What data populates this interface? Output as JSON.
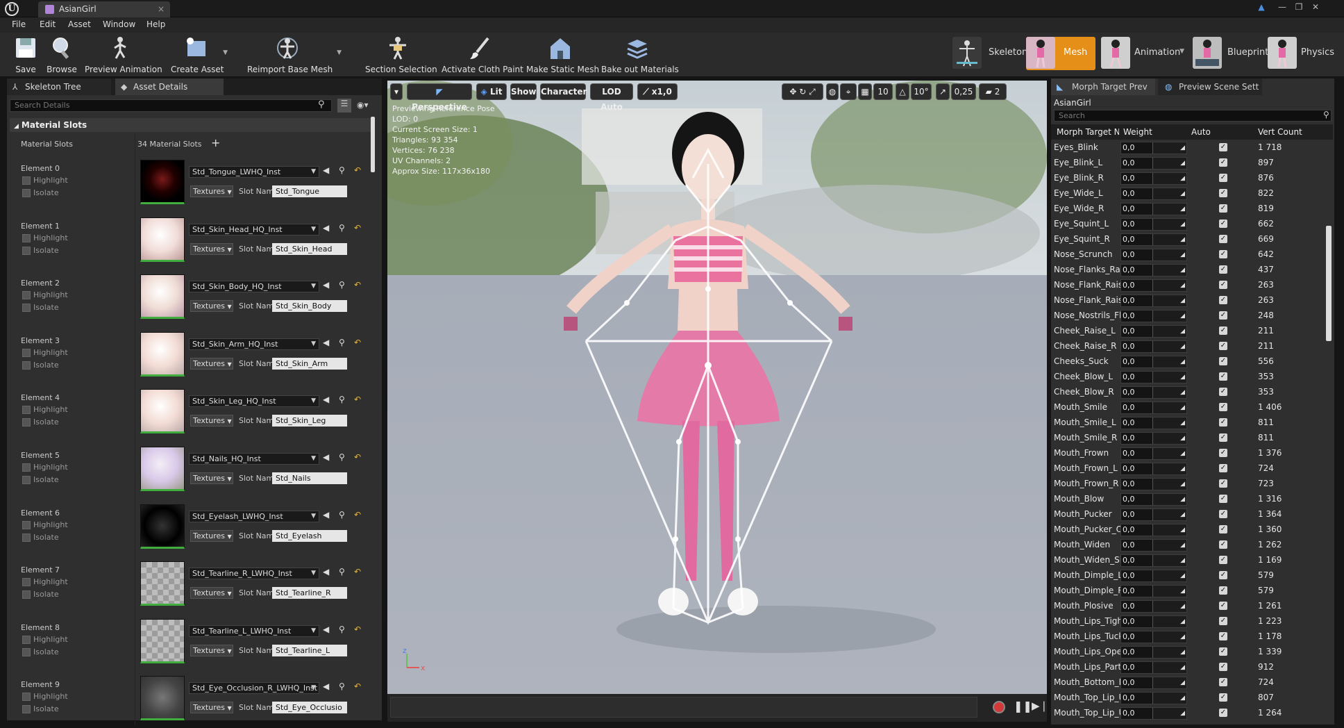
{
  "window": {
    "tab_title": "AsianGirl"
  },
  "menu": [
    "File",
    "Edit",
    "Asset",
    "Window",
    "Help"
  ],
  "toolbar": {
    "items": [
      "Save",
      "Browse",
      "Preview Animation",
      "Create Asset",
      "Reimport Base Mesh",
      "Section Selection",
      "Activate Cloth Paint",
      "Make Static Mesh",
      "Bake out Materials"
    ],
    "modes": [
      "Skeleton",
      "Mesh",
      "Animation",
      "Blueprint",
      "Physics"
    ]
  },
  "left": {
    "tabs": [
      "Skeleton Tree",
      "Asset Details"
    ],
    "search_placeholder": "Search Details",
    "section": "Material Slots",
    "col_label": "Material Slots",
    "slot_count": "34 Material Slots",
    "textures_label": "Textures",
    "slot_name_label": "Slot Name",
    "highlight_label": "Highlight",
    "isolate_label": "Isolate",
    "elements": [
      {
        "label": "Element 0",
        "material": "Std_Tongue_LWHQ_Inst",
        "slot": "Std_Tongue"
      },
      {
        "label": "Element 1",
        "material": "Std_Skin_Head_HQ_Inst",
        "slot": "Std_Skin_Head"
      },
      {
        "label": "Element 2",
        "material": "Std_Skin_Body_HQ_Inst",
        "slot": "Std_Skin_Body"
      },
      {
        "label": "Element 3",
        "material": "Std_Skin_Arm_HQ_Inst",
        "slot": "Std_Skin_Arm"
      },
      {
        "label": "Element 4",
        "material": "Std_Skin_Leg_HQ_Inst",
        "slot": "Std_Skin_Leg"
      },
      {
        "label": "Element 5",
        "material": "Std_Nails_HQ_Inst",
        "slot": "Std_Nails"
      },
      {
        "label": "Element 6",
        "material": "Std_Eyelash_LWHQ_Inst",
        "slot": "Std_Eyelash"
      },
      {
        "label": "Element 7",
        "material": "Std_Tearline_R_LWHQ_Inst",
        "slot": "Std_Tearline_R"
      },
      {
        "label": "Element 8",
        "material": "Std_Tearline_L_LWHQ_Inst",
        "slot": "Std_Tearline_L"
      },
      {
        "label": "Element 9",
        "material": "Std_Eye_Occlusion_R_LWHQ_Inst",
        "slot": "Std_Eye_Occlusio"
      }
    ]
  },
  "viewport": {
    "buttons": [
      "Perspective",
      "Lit",
      "Show",
      "Character",
      "LOD Auto",
      "x1,0"
    ],
    "right_values": [
      "10",
      "10°",
      "0,25",
      "2"
    ],
    "info": [
      "Previewing Reference Pose",
      "LOD: 0",
      "Current Screen Size: 1",
      "Triangles: 93 354",
      "Vertices: 76 238",
      "UV Channels: 2",
      "Approx Size: 117x36x180"
    ]
  },
  "right": {
    "tabs": [
      "Morph Target Prev",
      "Preview Scene Sett"
    ],
    "asset": "AsianGirl",
    "search_placeholder": "Search",
    "headers": [
      "Morph Target Na",
      "Weight",
      "Auto",
      "Vert Count"
    ],
    "rows": [
      {
        "name": "Eyes_Blink",
        "weight": "0,0",
        "count": "1 718"
      },
      {
        "name": "Eye_Blink_L",
        "weight": "0,0",
        "count": "897"
      },
      {
        "name": "Eye_Blink_R",
        "weight": "0,0",
        "count": "876"
      },
      {
        "name": "Eye_Wide_L",
        "weight": "0,0",
        "count": "822"
      },
      {
        "name": "Eye_Wide_R",
        "weight": "0,0",
        "count": "819"
      },
      {
        "name": "Eye_Squint_L",
        "weight": "0,0",
        "count": "662"
      },
      {
        "name": "Eye_Squint_R",
        "weight": "0,0",
        "count": "669"
      },
      {
        "name": "Nose_Scrunch",
        "weight": "0,0",
        "count": "642"
      },
      {
        "name": "Nose_Flanks_Rais",
        "weight": "0,0",
        "count": "437"
      },
      {
        "name": "Nose_Flank_Raise",
        "weight": "0,0",
        "count": "263"
      },
      {
        "name": "Nose_Flank_Raise",
        "weight": "0,0",
        "count": "263"
      },
      {
        "name": "Nose_Nostrils_Fla",
        "weight": "0,0",
        "count": "248"
      },
      {
        "name": "Cheek_Raise_L",
        "weight": "0,0",
        "count": "211"
      },
      {
        "name": "Cheek_Raise_R",
        "weight": "0,0",
        "count": "211"
      },
      {
        "name": "Cheeks_Suck",
        "weight": "0,0",
        "count": "556"
      },
      {
        "name": "Cheek_Blow_L",
        "weight": "0,0",
        "count": "353"
      },
      {
        "name": "Cheek_Blow_R",
        "weight": "0,0",
        "count": "353"
      },
      {
        "name": "Mouth_Smile",
        "weight": "0,0",
        "count": "1 406"
      },
      {
        "name": "Mouth_Smile_L",
        "weight": "0,0",
        "count": "811"
      },
      {
        "name": "Mouth_Smile_R",
        "weight": "0,0",
        "count": "811"
      },
      {
        "name": "Mouth_Frown",
        "weight": "0,0",
        "count": "1 376"
      },
      {
        "name": "Mouth_Frown_L",
        "weight": "0,0",
        "count": "724"
      },
      {
        "name": "Mouth_Frown_R",
        "weight": "0,0",
        "count": "723"
      },
      {
        "name": "Mouth_Blow",
        "weight": "0,0",
        "count": "1 316"
      },
      {
        "name": "Mouth_Pucker",
        "weight": "0,0",
        "count": "1 364"
      },
      {
        "name": "Mouth_Pucker_Op",
        "weight": "0,0",
        "count": "1 360"
      },
      {
        "name": "Mouth_Widen",
        "weight": "0,0",
        "count": "1 262"
      },
      {
        "name": "Mouth_Widen_Sid",
        "weight": "0,0",
        "count": "1 169"
      },
      {
        "name": "Mouth_Dimple_L",
        "weight": "0,0",
        "count": "579"
      },
      {
        "name": "Mouth_Dimple_R",
        "weight": "0,0",
        "count": "579"
      },
      {
        "name": "Mouth_Plosive",
        "weight": "0,0",
        "count": "1 261"
      },
      {
        "name": "Mouth_Lips_Tight",
        "weight": "0,0",
        "count": "1 223"
      },
      {
        "name": "Mouth_Lips_Tuck",
        "weight": "0,0",
        "count": "1 178"
      },
      {
        "name": "Mouth_Lips_Open",
        "weight": "0,0",
        "count": "1 339"
      },
      {
        "name": "Mouth_Lips_Part",
        "weight": "0,0",
        "count": "912"
      },
      {
        "name": "Mouth_Bottom_Li",
        "weight": "0,0",
        "count": "724"
      },
      {
        "name": "Mouth_Top_Lip_U",
        "weight": "0,0",
        "count": "807"
      },
      {
        "name": "Mouth_Top_Lip_U",
        "weight": "0,0",
        "count": "1 264"
      }
    ]
  }
}
